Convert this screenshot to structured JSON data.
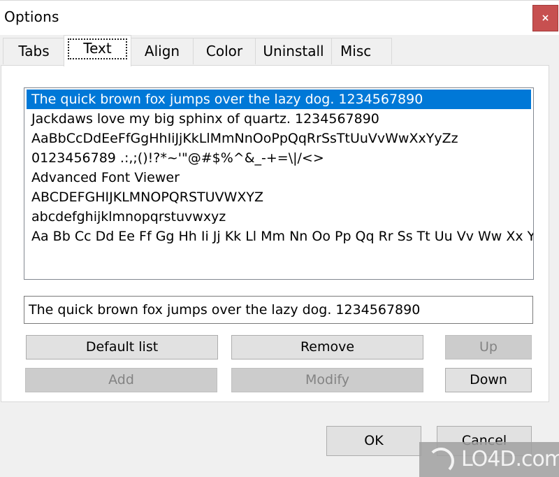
{
  "window": {
    "title": "Options",
    "close_glyph": "×"
  },
  "tabs": [
    {
      "label": "Tabs",
      "active": false
    },
    {
      "label": "Text",
      "active": true
    },
    {
      "label": "Align",
      "active": false
    },
    {
      "label": "Color",
      "active": false
    },
    {
      "label": "Uninstall",
      "active": false
    },
    {
      "label": "Misc",
      "active": false
    }
  ],
  "sample_list": {
    "selected_index": 0,
    "items": [
      "The quick brown fox jumps over the lazy dog. 1234567890",
      "Jackdaws love my big sphinx of quartz. 1234567890",
      "AaBbCcDdEeFfGgHhIiJjKkLlMmNnOoPpQqRrSsTtUuVvWwXxYyZz",
      "0123456789 .:,;()!?*~'\"@#$%^&_-+=\\|/<>",
      "Advanced Font Viewer",
      "ABCDEFGHIJKLMNOPQRSTUVWXYZ",
      "abcdefghijklmnopqrstuvwxyz",
      "Aa Bb Cc Dd Ee Ff Gg Hh Ii Jj Kk Ll Mm Nn Oo Pp Qq Rr Ss Tt Uu Vv Ww Xx Yy Zz"
    ]
  },
  "edit_field": {
    "value": "The quick brown fox jumps over the lazy dog. 1234567890"
  },
  "buttons": {
    "default_list": {
      "label": "Default list",
      "enabled": true
    },
    "remove": {
      "label": "Remove",
      "enabled": true
    },
    "up": {
      "label": "Up",
      "enabled": false
    },
    "add": {
      "label": "Add",
      "enabled": false
    },
    "modify": {
      "label": "Modify",
      "enabled": false
    },
    "down": {
      "label": "Down",
      "enabled": true
    },
    "ok": {
      "label": "OK",
      "enabled": true
    },
    "cancel": {
      "label": "Cancel",
      "enabled": true
    }
  },
  "watermark": {
    "text": "LO4D.com",
    "icon": "lo4d-logo-icon"
  },
  "colors": {
    "selection": "#0078d7",
    "close_button": "#c75050",
    "dialog_bg": "#f0f0f0"
  }
}
